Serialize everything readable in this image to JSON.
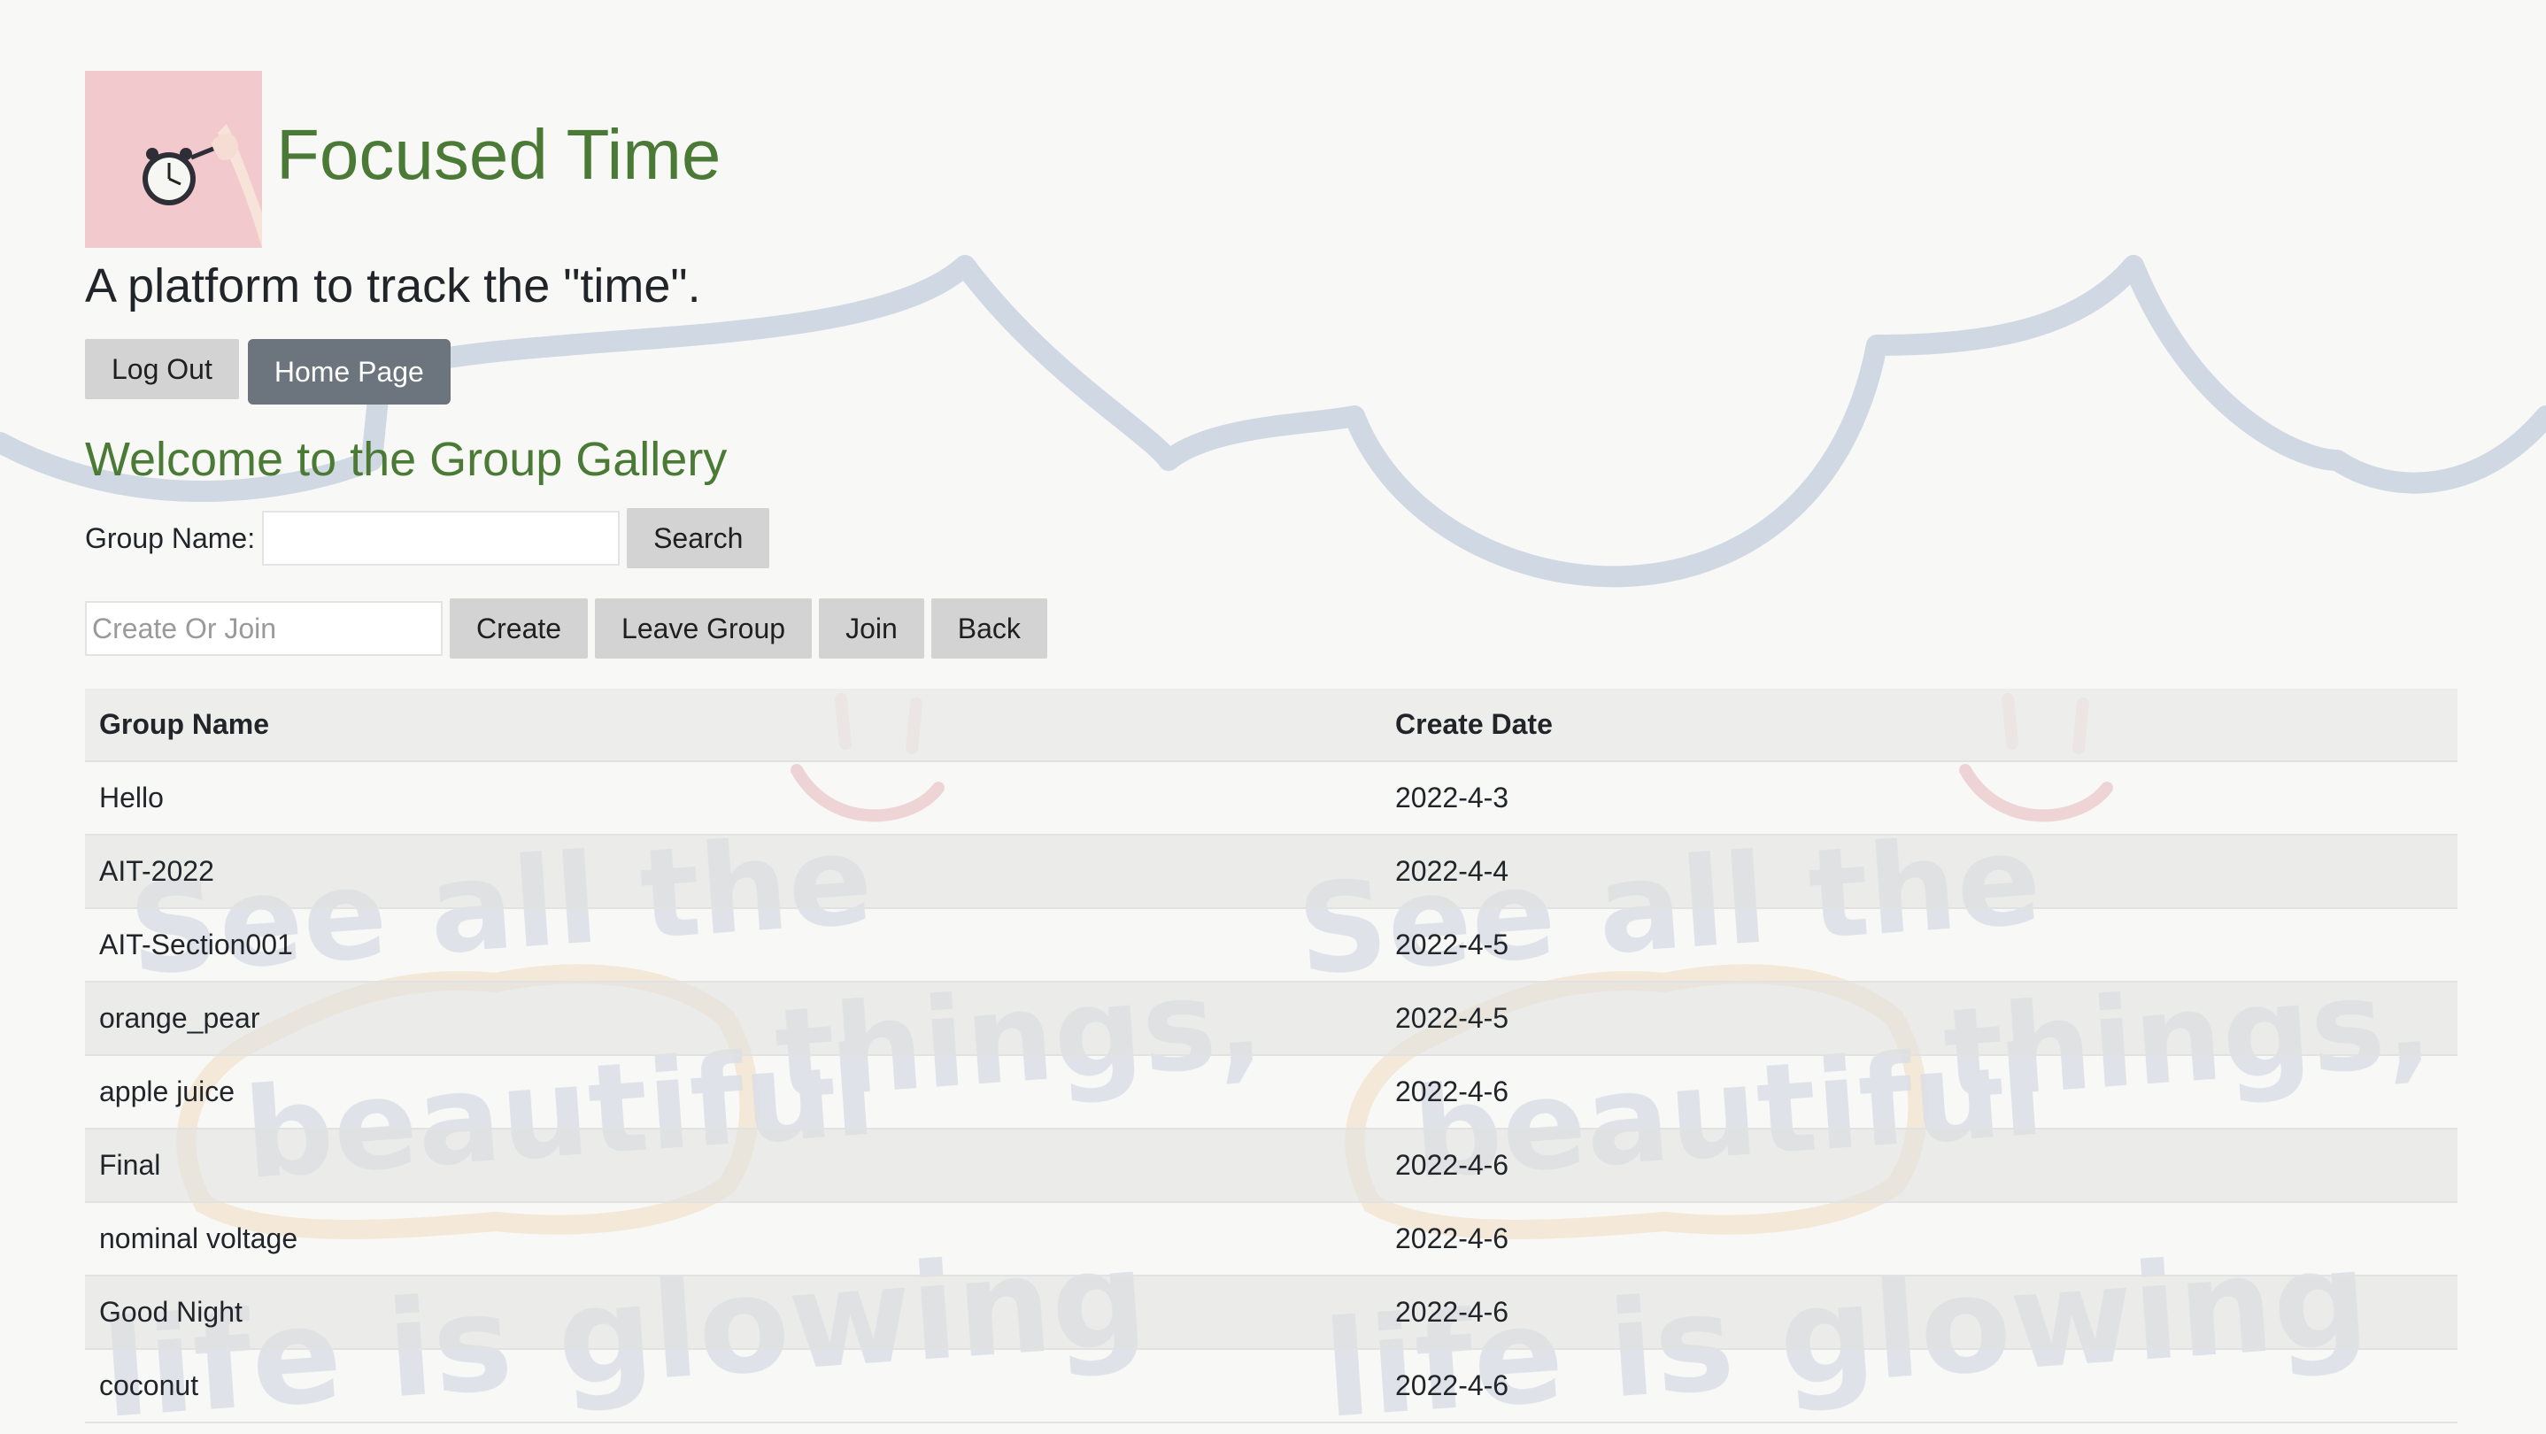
{
  "header": {
    "title": "Focused Time",
    "tagline": "A platform to track the \"time\".",
    "logo_icon": "alarm-clock-icon"
  },
  "nav": {
    "logout_label": "Log Out",
    "home_label": "Home Page"
  },
  "gallery": {
    "title": "Welcome to the Group Gallery",
    "search_label": "Group Name:",
    "search_value": "",
    "search_button": "Search",
    "group_placeholder": "Create Or Join",
    "create_button": "Create",
    "leave_button": "Leave Group",
    "join_button": "Join",
    "back_button": "Back"
  },
  "table": {
    "headers": [
      "Group Name",
      "Create Date"
    ],
    "rows": [
      [
        "Hello",
        "2022-4-3"
      ],
      [
        "AIT-2022",
        "2022-4-4"
      ],
      [
        "AIT-Section001",
        "2022-4-5"
      ],
      [
        "orange_pear",
        "2022-4-5"
      ],
      [
        "apple juice",
        "2022-4-6"
      ],
      [
        "Final",
        "2022-4-6"
      ],
      [
        "nominal voltage",
        "2022-4-6"
      ],
      [
        "Good Night",
        "2022-4-6"
      ],
      [
        "coconut",
        "2022-4-6"
      ]
    ]
  },
  "background": {
    "line1": "See all the",
    "line2_a": "beautiful",
    "line2_b": "things,",
    "line3": "life is glowing"
  },
  "colors": {
    "accent_green": "#4a7a35",
    "button_gray": "#d3d3d3",
    "button_dark": "#6c757d",
    "cloud_blue": "#c7d0de",
    "smile_pink": "#e8b9c0",
    "bubble_peach": "#f3ddc0"
  }
}
